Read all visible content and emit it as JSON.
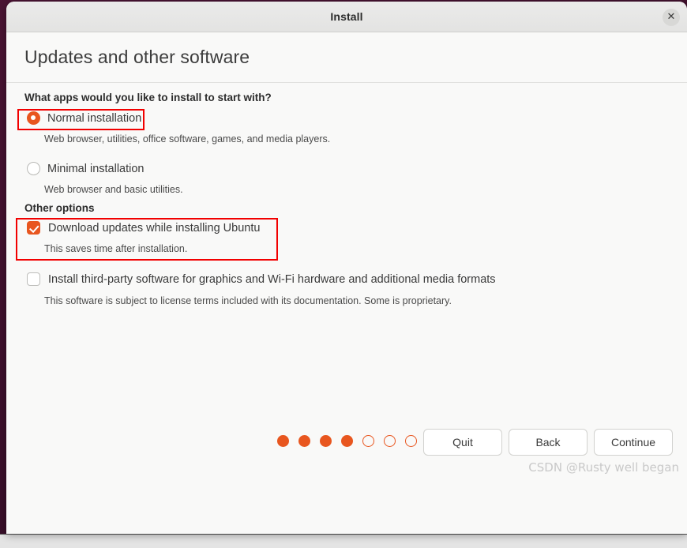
{
  "window": {
    "title": "Install",
    "close_icon": "close-icon",
    "close_glyph": "✕"
  },
  "page": {
    "heading": "Updates and other software"
  },
  "apps_section": {
    "question": "What apps would you like to install to start with?",
    "options": [
      {
        "label": "Normal installation",
        "description": "Web browser, utilities, office software, games, and media players.",
        "selected": true
      },
      {
        "label": "Minimal installation",
        "description": "Web browser and basic utilities.",
        "selected": false
      }
    ]
  },
  "other_options": {
    "heading": "Other options",
    "items": [
      {
        "label": "Download updates while installing Ubuntu",
        "description": "This saves time after installation.",
        "checked": true
      },
      {
        "label": "Install third-party software for graphics and Wi-Fi hardware and additional media formats",
        "description": "This software is subject to license terms included with its documentation. Some is proprietary.",
        "checked": false
      }
    ]
  },
  "footer": {
    "quit_label": "Quit",
    "back_label": "Back",
    "continue_label": "Continue"
  },
  "progress": {
    "total_steps": 7,
    "completed_steps": 4
  },
  "watermark": {
    "text": "CSDN @Rusty well began"
  },
  "colors": {
    "accent": "#e8561f",
    "annotation": "#f20000",
    "window_bg": "#f9f9f8",
    "titlebar_bg": "#e8e8e7",
    "desktop_bg": "#3d1030"
  }
}
